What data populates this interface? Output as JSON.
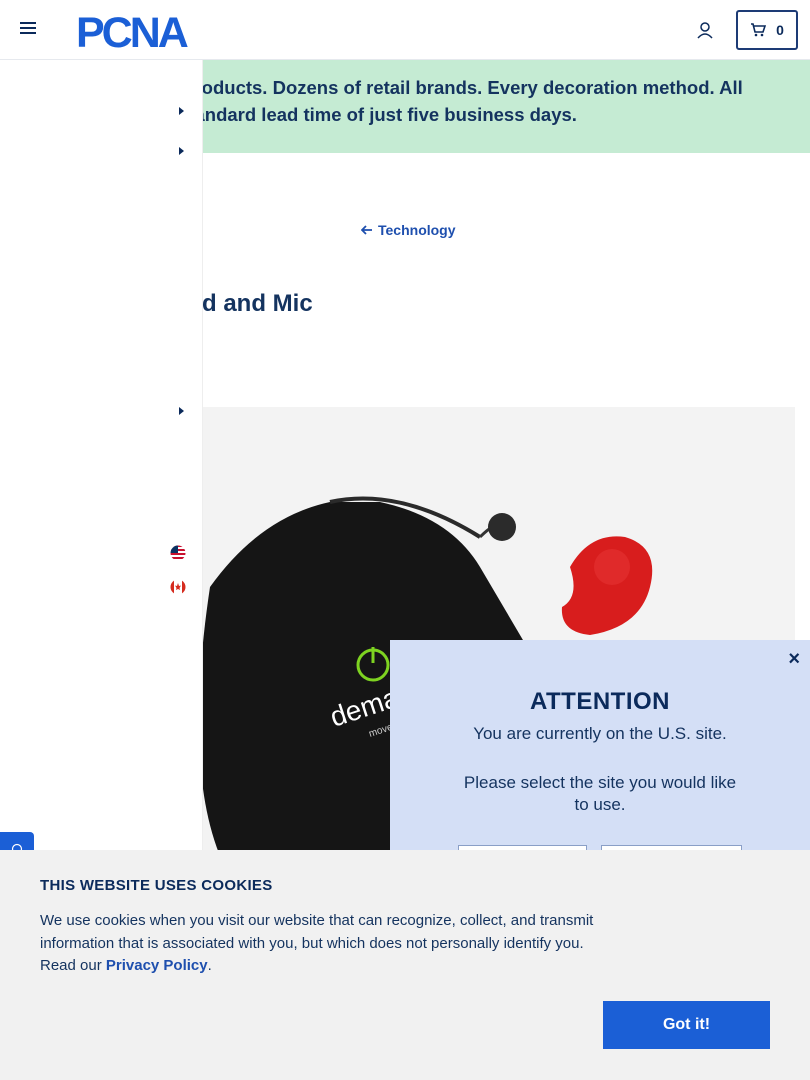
{
  "header": {
    "logo_text": "PCNA",
    "cart_count": "0"
  },
  "banner": {
    "text": "ls of products. Dozens of retail brands. Every decoration method. All",
    "text2": "th a standard lead time of just five business days."
  },
  "breadcrumb": {
    "label": "Technology"
  },
  "product": {
    "title": "arbud and Mic",
    "bag_brand_text": "dema",
    "bag_tagline": "move"
  },
  "modal": {
    "title": "ATTENTION",
    "line1": "You are currently on the U.S. site.",
    "line2": "Please select the site you would like to use.",
    "close": "×"
  },
  "cookie": {
    "title": "THIS WEBSITE USES COOKIES",
    "text": "We use cookies when you visit our website that can recognize, collect, and transmit information that is associated with you, but which does not personally identify you. Read our ",
    "link": "Privacy Policy",
    "period": ".",
    "button": "Got it!"
  },
  "colors": {
    "navy": "#0b2a5b",
    "blue": "#1b5fd6",
    "banner_green": "#c5ebd3",
    "modal_bg": "#d4dff6"
  },
  "icons": [
    "hamburger-icon",
    "account-icon",
    "cart-icon",
    "arrow-left-icon",
    "caret-right-icon",
    "us-flag-icon",
    "canada-flag-icon",
    "feedback-icon",
    "close-icon"
  ]
}
